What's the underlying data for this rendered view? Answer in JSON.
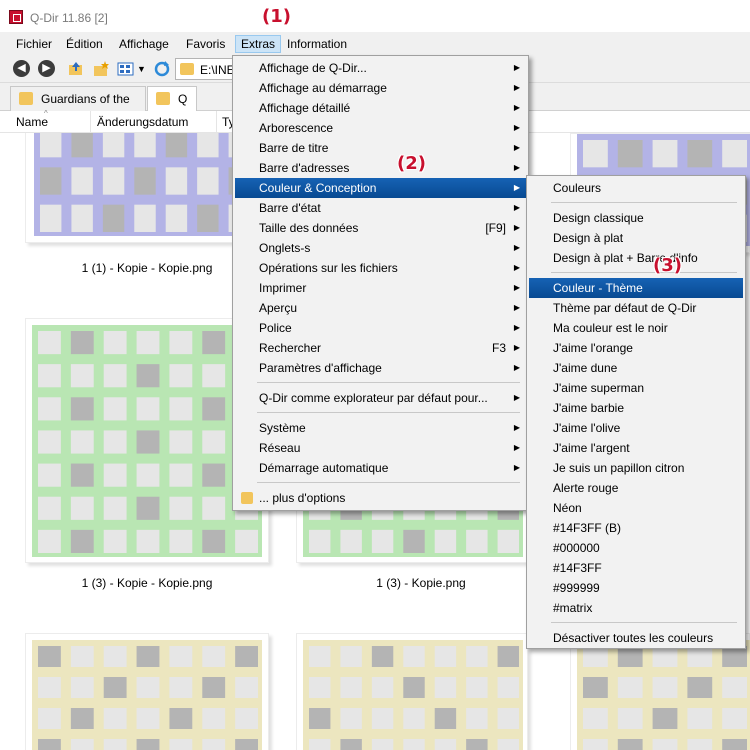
{
  "window": {
    "title": "Q-Dir 11.86 [2]"
  },
  "menubar": [
    "Fichier",
    "Édition",
    "Affichage",
    "Favoris",
    "Extras",
    "Information"
  ],
  "toolbar": {
    "address": "E:\\INE"
  },
  "tabs": [
    "Guardians of the",
    "Q"
  ],
  "columns": [
    "Name",
    "Änderungsdatum",
    "Ty"
  ],
  "files": [
    "1 (1) - Kopie - Kopie.png",
    "1 (3) - Kopie - Kopie.png",
    "1 (3) - Kopie.png"
  ],
  "annotations": [
    "(1)",
    "(2)",
    "(3)"
  ],
  "extras_menu": [
    {
      "label": "Affichage de Q-Dir...",
      "submenu": true
    },
    {
      "label": "Affichage au démarrage",
      "submenu": true
    },
    {
      "label": "Affichage détaillé",
      "submenu": true
    },
    {
      "label": "Arborescence",
      "submenu": true
    },
    {
      "label": "Barre de titre",
      "submenu": true
    },
    {
      "label": "Barre d'adresses",
      "submenu": true
    },
    {
      "label": "Couleur & Conception",
      "submenu": true,
      "highlighted": true
    },
    {
      "label": "Barre d'état",
      "submenu": true
    },
    {
      "label": "Taille des données",
      "shortcut": "[F9]",
      "submenu": true
    },
    {
      "label": "Onglets-s",
      "submenu": true
    },
    {
      "label": "Opérations sur les fichiers",
      "submenu": true
    },
    {
      "label": "Imprimer",
      "submenu": true
    },
    {
      "label": "Aperçu",
      "submenu": true
    },
    {
      "label": "Police",
      "submenu": true
    },
    {
      "label": "Rechercher",
      "shortcut": "F3",
      "submenu": true
    },
    {
      "label": "Paramètres d'affichage",
      "submenu": true
    },
    {
      "separator": true
    },
    {
      "label": "Q-Dir comme explorateur par défaut pour...",
      "submenu": true
    },
    {
      "separator": true
    },
    {
      "label": "Système",
      "submenu": true
    },
    {
      "label": "Réseau",
      "submenu": true
    },
    {
      "label": "Démarrage automatique",
      "submenu": true
    },
    {
      "separator": true
    },
    {
      "label": "... plus d'options",
      "folder_icon": true
    }
  ],
  "color_menu": [
    {
      "label": "Couleurs"
    },
    {
      "separator": true
    },
    {
      "label": "Design classique"
    },
    {
      "label": "Design à plat"
    },
    {
      "label": "Design à plat + Barre d'info"
    },
    {
      "separator": true
    },
    {
      "label": "Couleur - Thème",
      "highlighted": true
    },
    {
      "label": "Thème par défaut de Q-Dir"
    },
    {
      "label": "Ma couleur est le noir"
    },
    {
      "label": "J'aime l'orange"
    },
    {
      "label": "J'aime dune"
    },
    {
      "label": "J'aime superman"
    },
    {
      "label": "J'aime barbie"
    },
    {
      "label": "J'aime l'olive"
    },
    {
      "label": "J'aime l'argent"
    },
    {
      "label": "Je suis un papillon citron"
    },
    {
      "label": "Alerte rouge"
    },
    {
      "label": "Néon"
    },
    {
      "label": "#14F3FF (B)"
    },
    {
      "label": "#000000"
    },
    {
      "label": "#14F3FF"
    },
    {
      "label": "#999999"
    },
    {
      "label": "#matrix"
    },
    {
      "separator": true
    },
    {
      "label": "Désactiver toutes les couleurs"
    }
  ],
  "colors": {
    "highlight": "#0a58a8",
    "annotation": "#c8102e",
    "thumb_blue": "#b3b3e6",
    "thumb_green": "#b9e6b3",
    "thumb_yellow": "#ece6bf"
  }
}
